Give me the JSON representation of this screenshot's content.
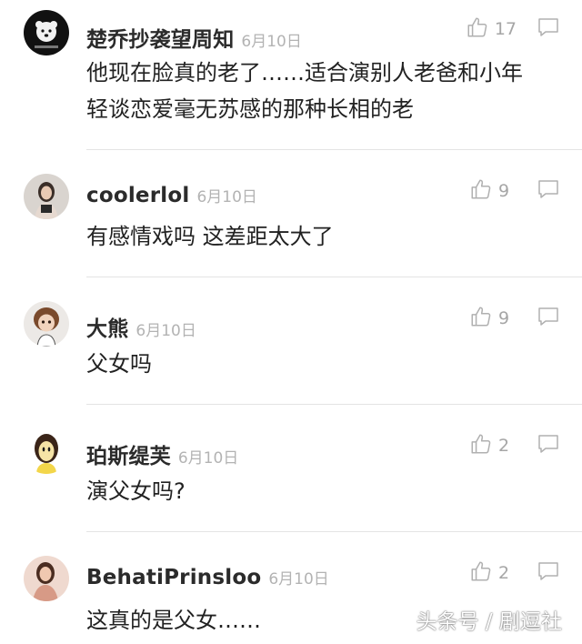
{
  "comments": [
    {
      "username": "楚乔抄袭望周知",
      "date": "6月10日",
      "text": "他现在脸真的老了……适合演别人老爸和小年\n轻谈恋爱毫无苏感的那种长相的老",
      "likes": "17",
      "avatar": "black-dog-avatar"
    },
    {
      "username": "coolerlol",
      "date": "6月10日",
      "text": "有感情戏吗 这差距太大了",
      "likes": "9",
      "avatar": "girl-photo-avatar"
    },
    {
      "username": "大熊",
      "date": "6月10日",
      "text": "父女吗",
      "likes": "9",
      "avatar": "doll-avatar"
    },
    {
      "username": "珀斯缇芙",
      "date": "6月10日",
      "text": "演父女吗?",
      "likes": "2",
      "avatar": "cartoon-face-avatar"
    },
    {
      "username": "BehatiPrinsloo",
      "date": "6月10日",
      "text": "这真的是父女……",
      "likes": "2",
      "avatar": "model-photo-avatar"
    }
  ],
  "watermark": "头条号 / 剧逗社",
  "colors": {
    "username": "#2b2b2b",
    "date": "#b3b3b3",
    "icon": "#b0b0b0",
    "divider": "#e4e4e4"
  },
  "icons": {
    "like": "thumbs-up-icon",
    "reply": "speech-bubble-icon"
  }
}
